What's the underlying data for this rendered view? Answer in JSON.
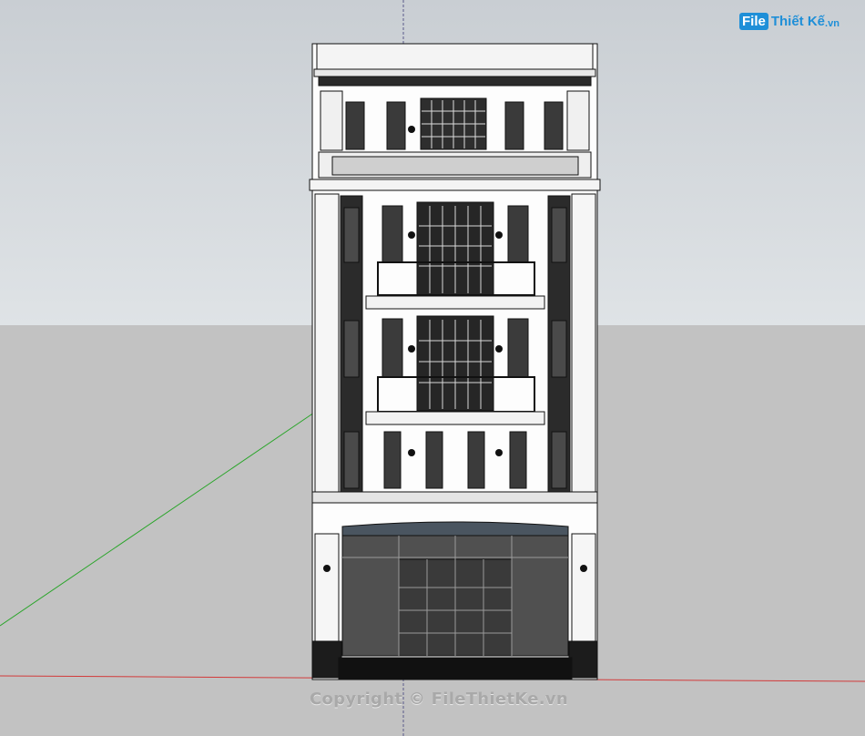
{
  "watermark_logo": {
    "badge": "File",
    "text": "Thiết Kế",
    "tld": ".vn"
  },
  "copyright": "Copyright © FileThietKe.vn",
  "scene": {
    "background": {
      "sky": "#c9ced3",
      "ground": "#c2c2c2"
    },
    "axes": {
      "red_axis": "#d23a3a",
      "green_axis": "#2aa52a",
      "blue_axis": "#4444aa"
    },
    "model": "townhouse-facade"
  }
}
